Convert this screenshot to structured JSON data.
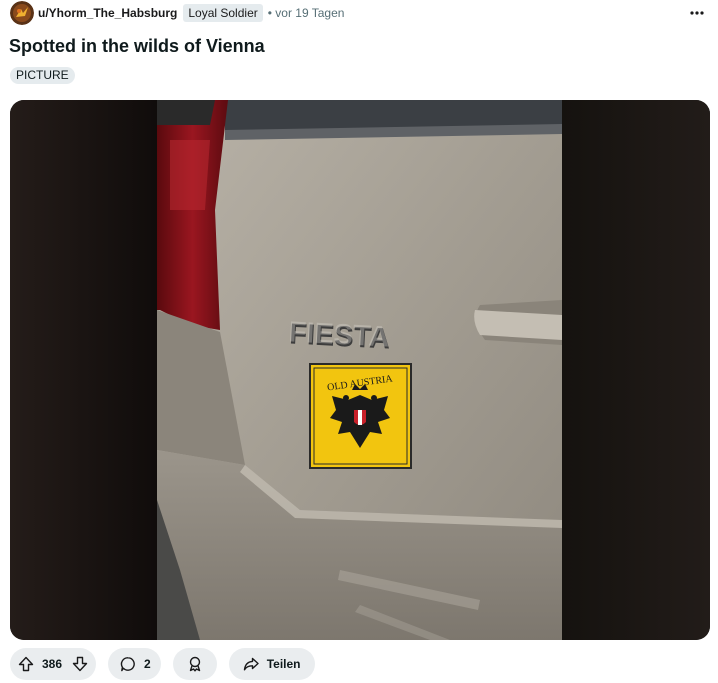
{
  "post": {
    "username": "u/Yhorm_The_Habsburg",
    "user_flair": "Loyal Soldier",
    "time": "• vor 19 Tagen",
    "title": "Spotted in the wilds of Vienna",
    "tag": "PICTURE"
  },
  "image": {
    "car_badge": "FIESTA",
    "sticker_text": "OLD AUSTRIA"
  },
  "actions": {
    "upvotes": "386",
    "comments": "2",
    "share_label": "Teilen"
  },
  "icons": {
    "more": "more-horizontal-icon",
    "upvote": "upvote-icon",
    "downvote": "downvote-icon",
    "comment": "comment-icon",
    "award": "award-icon",
    "share": "share-icon"
  },
  "colors": {
    "flair_bg": "#e5ebee",
    "pill_bg": "#eaedef",
    "sticker_yellow": "#f2c50f",
    "time_gray": "#576f76"
  }
}
